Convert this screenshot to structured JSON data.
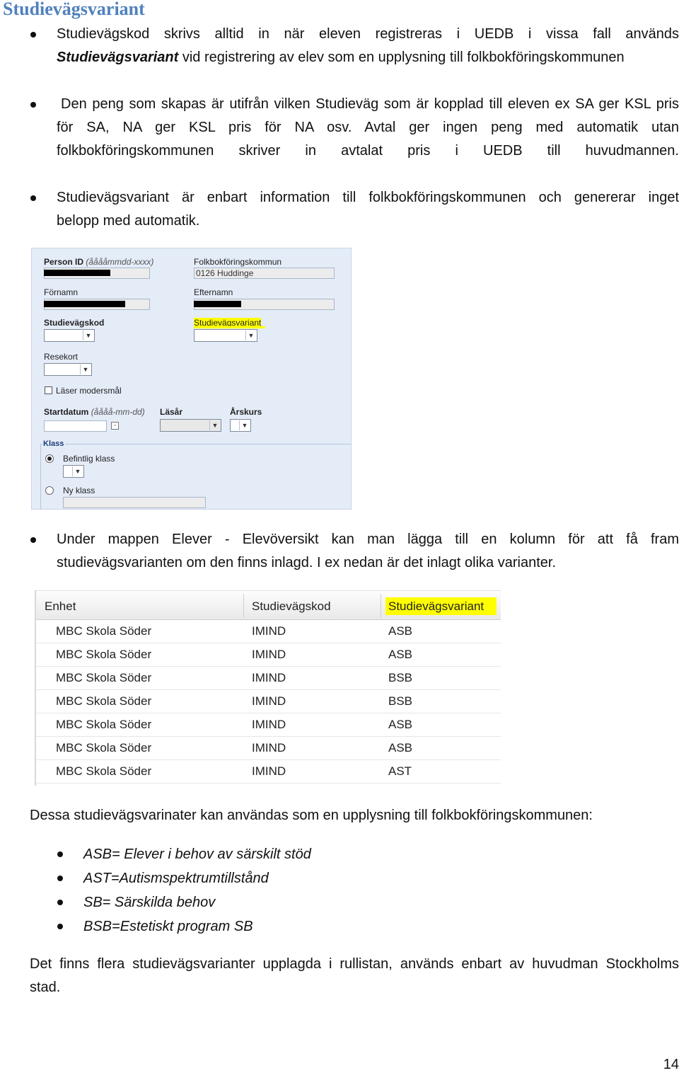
{
  "heading": "Studievägsvariant",
  "bullets": {
    "b1": {
      "line1": "Studievägskod skrivs alltid in när eleven registreras i UEDB i vissa fall används",
      "line2_bold": "Studievägsvariant",
      "line2_rest": " vid registrering av elev som en upplysning till folkbokföringskommunen"
    },
    "b2": {
      "line1": "Den peng som skapas är utifrån vilken Studieväg som är kopplad till eleven ex SA ger KSL pris",
      "line2": "för SA, NA ger KSL pris för NA osv. Avtal ger ingen peng med automatik utan",
      "line3": "folkbokföringskommunen skriver in avtalat pris i UEDB till huvudmannen."
    },
    "b3": {
      "line1": "Studievägsvariant är enbart information till folkbokföringskommunen och genererar inget",
      "line2": "belopp med automatik."
    },
    "b4": {
      "line1": "Under mappen Elever - Elevöversikt kan man lägga till en kolumn för att få fram",
      "line2": "studievägsvarianten om den finns inlagd. I ex nedan är det inlagt olika varianter."
    }
  },
  "form": {
    "person_id_label": "Person ID",
    "person_id_hint": "(ååååmmdd-xxxx)",
    "folkbokforing_label": "Folkbokföringskommun",
    "folkbokforing_value": "0126 Huddinge",
    "fornamn_label": "Förnamn",
    "efternamn_label": "Efternamn",
    "studievagskod_label": "Studievägskod",
    "studievagsvariant_label": "Studievägsvariant",
    "resekort_label": "Resekort",
    "modersmal_label": "Läser modersmål",
    "startdatum_label": "Startdatum",
    "startdatum_hint": "(åååå-mm-dd)",
    "lasar_label": "Läsår",
    "arskurs_label": "Årskurs",
    "klass_label": "Klass",
    "befintlig_label": "Befintlig klass",
    "ny_label": "Ny klass",
    "highlight_color": "#ffff00"
  },
  "table": {
    "headers": [
      "Enhet",
      "Studievägskod",
      "Studievägsvariant"
    ],
    "rows": [
      [
        "MBC Skola Söder",
        "IMIND",
        "ASB"
      ],
      [
        "MBC Skola Söder",
        "IMIND",
        "ASB"
      ],
      [
        "MBC Skola Söder",
        "IMIND",
        "BSB"
      ],
      [
        "MBC Skola Söder",
        "IMIND",
        "BSB"
      ],
      [
        "MBC Skola Söder",
        "IMIND",
        "ASB"
      ],
      [
        "MBC Skola Söder",
        "IMIND",
        "ASB"
      ],
      [
        "MBC Skola Söder",
        "IMIND",
        "AST"
      ]
    ]
  },
  "intro_text": "Dessa studievägsvarinater kan användas som en upplysning till folkbokföringskommunen:",
  "variants": [
    "ASB= Elever i behov av särskilt stöd",
    "AST=Autismspektrumtillstånd",
    "SB= Särskilda behov",
    "BSB=Estetiskt program SB"
  ],
  "closing": {
    "line1": "Det finns flera studievägsvarianter upplagda i rullistan, används enbart av huvudman Stockholms",
    "line2": "stad."
  },
  "page_number": "14"
}
